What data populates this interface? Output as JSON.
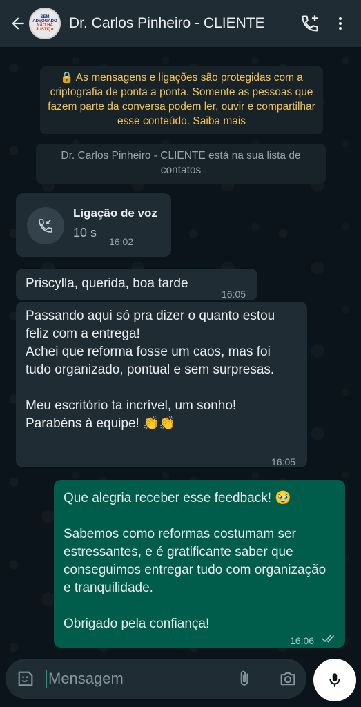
{
  "header": {
    "title": "Dr. Carlos Pinheiro - CLIENTE",
    "avatar_logo_lines": [
      "SEM",
      "ADVOGADO",
      "NÃO HÁ",
      "JUSTIÇA"
    ]
  },
  "system": {
    "encryption_notice": "🔒 As mensagens e ligações são protegidas com a criptografia de ponta a ponta. Somente as pessoas que fazem parte da conversa podem ler, ouvir e compartilhar esse conteúdo. Saiba mais",
    "contact_notice": "Dr. Carlos Pinheiro - CLIENTE está na sua lista de contatos"
  },
  "messages": [
    {
      "type": "call",
      "title": "Ligação de voz",
      "duration": "10 s",
      "time": "16:02"
    },
    {
      "type": "incoming",
      "text": "Priscylla, querida, boa tarde",
      "time": "16:05"
    },
    {
      "type": "incoming",
      "text": "Passando aqui só pra dizer o quanto estou feliz com a entrega!\nAchei que reforma fosse um caos, mas foi tudo organizado, pontual e sem surpresas.\n\nMeu escritório ta incrível, um sonho! Parabéns à equipe! 👏👏",
      "time": "16:05"
    },
    {
      "type": "outgoing",
      "text": "Que alegria receber esse feedback! 🥹\n\nSabemos como reformas costumam ser estressantes, e é gratificante saber que conseguimos entregar tudo com organização e tranquilidade.\n\nObrigado pela confiança!",
      "time": "16:06",
      "status": "read"
    }
  ],
  "composer": {
    "placeholder": "Mensagem"
  },
  "colors": {
    "background": "#0b141a",
    "header": "#1f2c34",
    "incoming_bubble": "#1f2c34",
    "outgoing_bubble": "#005c4b",
    "encryption_text": "#f5c35a"
  }
}
